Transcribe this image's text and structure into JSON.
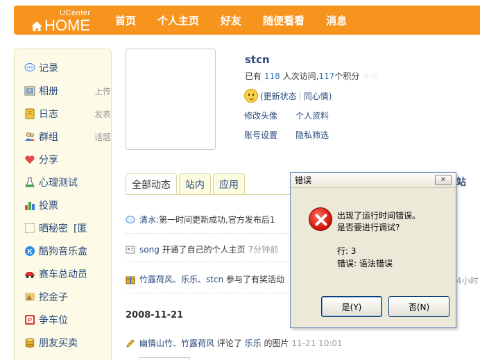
{
  "header": {
    "logo_small": "UCenter",
    "logo_main": "HOME",
    "nav": [
      "首页",
      "个人主页",
      "好友",
      "随便看看",
      "消息"
    ],
    "accent_color": "#f7941d"
  },
  "sidebar": {
    "items": [
      {
        "label": "记录",
        "sub": "",
        "icon": "speech-bubble-icon"
      },
      {
        "label": "相册",
        "sub": "上传",
        "icon": "photo-icon"
      },
      {
        "label": "日志",
        "sub": "发表",
        "icon": "notebook-icon"
      },
      {
        "label": "群组",
        "sub": "话题",
        "icon": "group-icon"
      },
      {
        "label": "分享",
        "sub": "",
        "icon": "heart-icon"
      },
      {
        "label": "心理测试",
        "sub": "",
        "icon": "flask-icon"
      },
      {
        "label": "投票",
        "sub": "",
        "icon": "bar-chart-icon"
      },
      {
        "label": "晒秘密",
        "sub": "[匿",
        "icon": "dotted-box-icon"
      },
      {
        "label": "酷狗音乐盒",
        "sub": "",
        "icon": "music-icon"
      },
      {
        "label": "赛车总动员",
        "sub": "",
        "icon": "car-icon"
      },
      {
        "label": "挖金子",
        "sub": "",
        "icon": "gold-icon"
      },
      {
        "label": "争车位",
        "sub": "",
        "icon": "parking-icon"
      },
      {
        "label": "朋友买卖",
        "sub": "",
        "icon": "coins-icon"
      }
    ]
  },
  "profile": {
    "username": "stcn",
    "stats_prefix": "已有",
    "visits": "118",
    "visits_suffix": "人次访问,",
    "points": "117",
    "points_suffix": "个积分",
    "update_status": "(更新状态",
    "same_mood": "同心情)",
    "links": [
      "修改头像",
      "个人资料",
      "账号设置",
      "隐私筛选"
    ]
  },
  "tabs": {
    "items": [
      "全部动态",
      "站内",
      "应用"
    ],
    "active_index": 0,
    "peek_right": "站"
  },
  "feed": [
    {
      "actor": "清水",
      "text": ":第一时间更新成功,官方发布后1",
      "time": ""
    },
    {
      "actor": "song",
      "text": "开通了自己的个人主页",
      "time": "7分钟前"
    },
    {
      "actor": "竹露荷风、乐乐、stcn",
      "text": "参与了有奖活动",
      "time": ""
    }
  ],
  "feed_peek_right": "4小时",
  "date_header": "2008-11-21",
  "feed_after": {
    "actor": "幽情山竹、竹露荷风",
    "verb": "评论了",
    "target": "乐乐",
    "rest": "的图片",
    "time": "11-21 10:01"
  },
  "dialog": {
    "title": "错误",
    "close_label": "✕",
    "line1": "出现了运行时间错误。",
    "line2": "是否要进行调试?",
    "line3": "行: 3",
    "line4": "错误: 语法错误",
    "yes_label": "是(Y)",
    "no_label": "否(N)"
  }
}
